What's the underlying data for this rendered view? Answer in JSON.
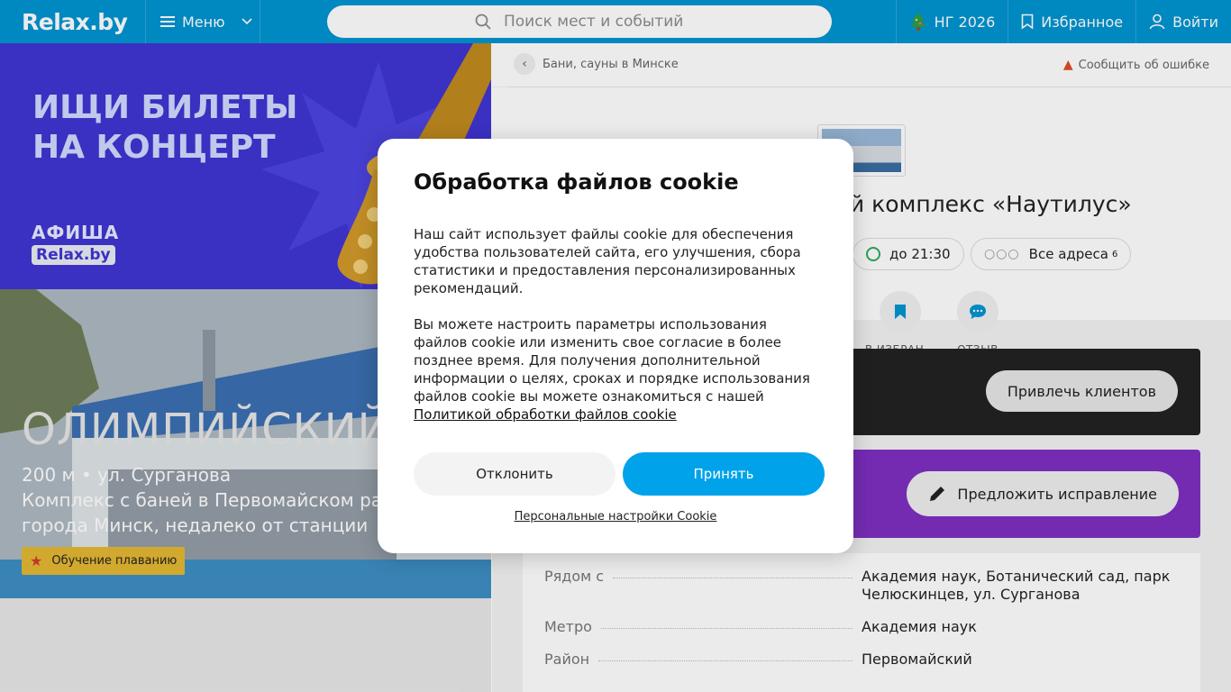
{
  "header": {
    "logo": "Relax.by",
    "menu_label": "Меню",
    "search_placeholder": "Поиск мест и событий",
    "ny_label": "НГ 2026",
    "favorites_label": "Избранное",
    "login_label": "Войти"
  },
  "banner": {
    "title": "ИЩИ БИЛЕТЫ\nНА КОНЦЕРТ",
    "brand_top": "АФИША",
    "brand_bottom": "Relax.by"
  },
  "hero": {
    "title": "ОЛИМПИЙСКИЙ",
    "subtitle": "200 м • ул. Сурганова\nКомплекс с баней в Первомайском районе\nгорода Минск, недалеко от станции",
    "tag": "Обучение плаванию"
  },
  "venue": {
    "breadcrumb": "Бани, сауны в Минске",
    "report_label": "Сообщить об ошибке",
    "title": "Банный комплекс «Наутилус»",
    "hours": "до 21:30",
    "addresses_label": "Все адреса",
    "addresses_count": "6",
    "actions": [
      {
        "label": "В ИЗБРАН...",
        "icon": "bookmark-icon"
      },
      {
        "label": "ОТЗЫВ",
        "icon": "chat-icon"
      }
    ],
    "promo_button": "Привлечь клиентов",
    "edit_button": "Предложить исправление",
    "details": [
      {
        "label": "Рядом с",
        "value": "Академия наук, Ботанический сад, парк Челюскинцев, ул. Сурганова"
      },
      {
        "label": "Метро",
        "value": "Академия наук"
      },
      {
        "label": "Район",
        "value": "Первомайский"
      }
    ]
  },
  "cookie_modal": {
    "title": "Обработка файлов cookie",
    "paragraph1": "Наш сайт использует файлы cookie для обеспечения удобства пользователей сайта, его улучшения, сбора статистики и предоставления персонализированных рекомендаций.",
    "paragraph2": "Вы можете настроить параметры использования файлов cookie или изменить свое согласие в более позднее время. Для получения дополнительной информации о целях, сроках и порядке использования файлов cookie вы можете ознакомиться с нашей",
    "policy_link": "Политикой обработки файлов cookie",
    "decline": "Отклонить",
    "accept": "Принять",
    "settings_link": "Персональные настройки Cookie"
  },
  "colors": {
    "brand_blue": "#0094d1",
    "accept_blue": "#00a2ea",
    "banner_purple": "#3f35d3",
    "edit_purple": "#7e2fc2"
  }
}
